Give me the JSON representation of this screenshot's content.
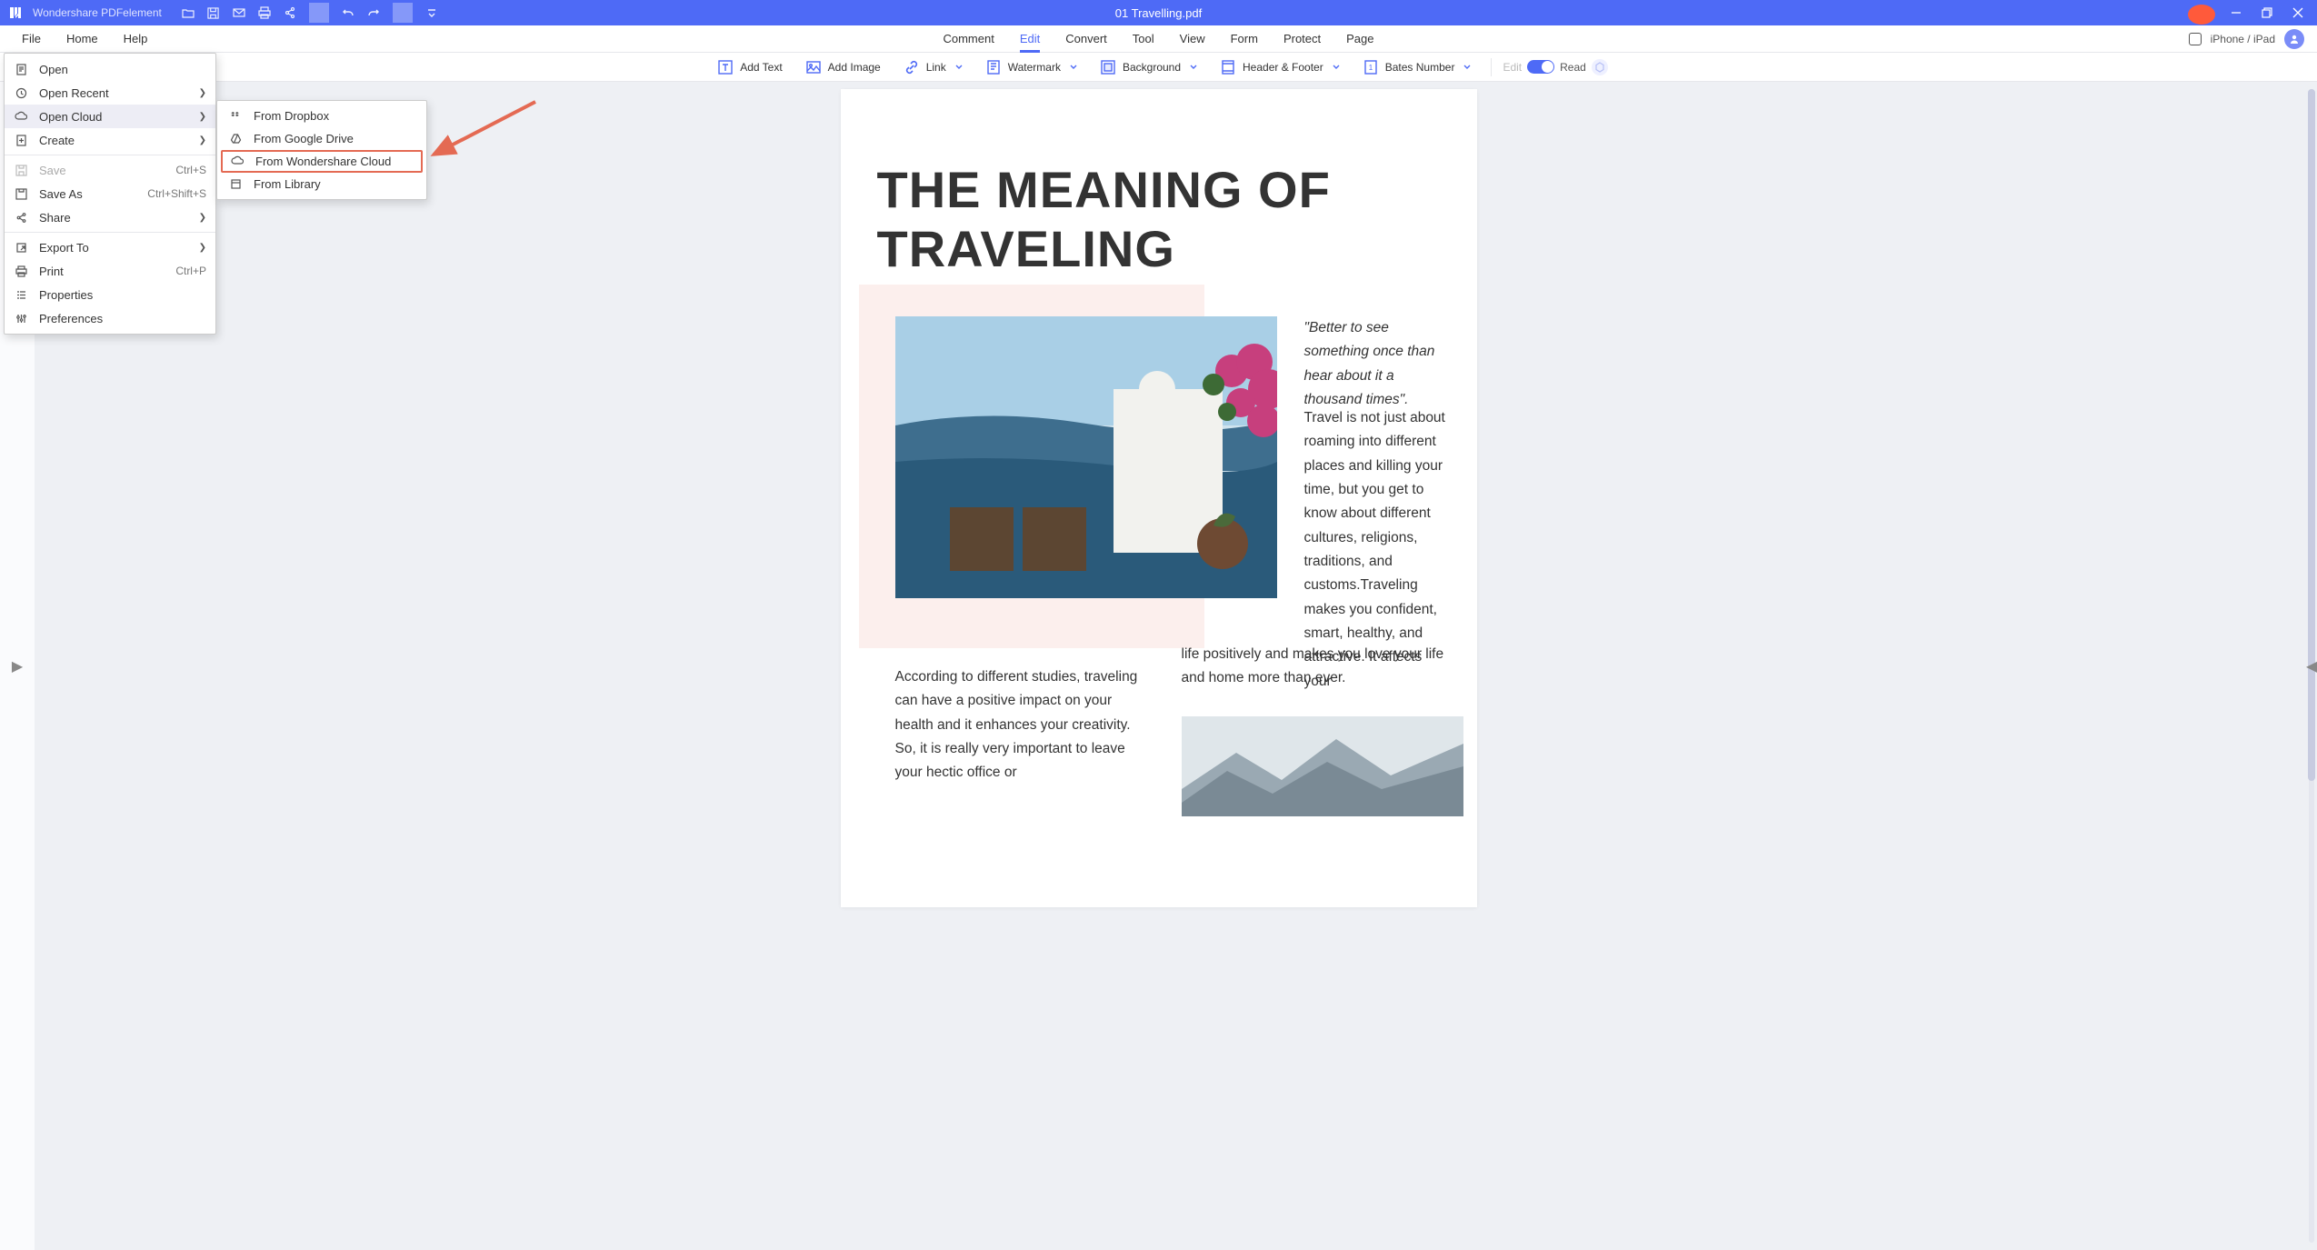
{
  "titlebar": {
    "app_name": "Wondershare PDFelement",
    "doc_title": "01 Travelling.pdf"
  },
  "menubar": {
    "left": [
      "File",
      "Home",
      "Help"
    ],
    "center": [
      "Comment",
      "Edit",
      "Convert",
      "Tool",
      "View",
      "Form",
      "Protect",
      "Page"
    ],
    "active": "Edit",
    "device_label": "iPhone / iPad"
  },
  "toolbar": {
    "add_text": "Add Text",
    "add_image": "Add Image",
    "link": "Link",
    "watermark": "Watermark",
    "background": "Background",
    "header_footer": "Header & Footer",
    "bates": "Bates Number",
    "edit": "Edit",
    "read": "Read"
  },
  "file_menu": {
    "open": "Open",
    "open_recent": "Open Recent",
    "open_cloud": "Open Cloud",
    "create": "Create",
    "save": "Save",
    "save_k": "Ctrl+S",
    "save_as": "Save As",
    "save_as_k": "Ctrl+Shift+S",
    "share": "Share",
    "export": "Export To",
    "print": "Print",
    "print_k": "Ctrl+P",
    "properties": "Properties",
    "preferences": "Preferences"
  },
  "cloud_menu": {
    "dropbox": "From Dropbox",
    "gdrive": "From Google Drive",
    "wcloud": "From Wondershare Cloud",
    "library": "From Library"
  },
  "doc": {
    "heading": "THE MEANING OF TRAVELING",
    "quote": "\"Better to see something once than hear about it a thousand times\".",
    "para2": "Travel is not just about roaming into different places and killing your time, but you get to know about different cultures, religions, traditions, and customs.Traveling makes you confident, smart, healthy, and attractive. It affects your life positively and makes you love your life and home more than ever.",
    "para1": "According to different studies, traveling can have a positive impact on your health and it enhances your creativity. So, it is really very important to leave your hectic office or"
  }
}
